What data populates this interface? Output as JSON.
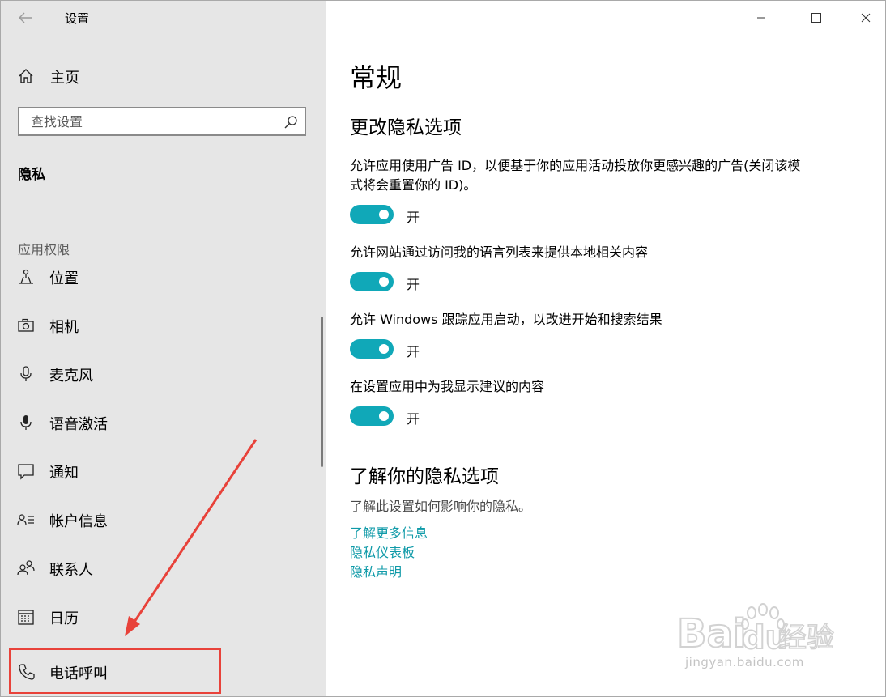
{
  "window": {
    "title": "设置",
    "controls": {
      "minimize": "minimize-icon",
      "maximize": "maximize-icon",
      "close": "close-icon"
    }
  },
  "sidebar": {
    "home_label": "主页",
    "search_placeholder": "查找设置",
    "section_label": "隐私",
    "group_label": "应用权限",
    "items": [
      {
        "label": "位置",
        "icon": "location-icon"
      },
      {
        "label": "相机",
        "icon": "camera-icon"
      },
      {
        "label": "麦克风",
        "icon": "microphone-icon"
      },
      {
        "label": "语音激活",
        "icon": "voice-activation-icon"
      },
      {
        "label": "通知",
        "icon": "notification-icon"
      },
      {
        "label": "帐户信息",
        "icon": "account-info-icon"
      },
      {
        "label": "联系人",
        "icon": "contacts-icon"
      },
      {
        "label": "日历",
        "icon": "calendar-icon"
      },
      {
        "label": "电话呼叫",
        "icon": "phone-icon",
        "highlighted": true
      }
    ]
  },
  "main": {
    "page_title": "常规",
    "sub_title": "更改隐私选项",
    "settings": [
      {
        "desc": "允许应用使用广告 ID，以便基于你的应用活动投放你更感兴趣的广告(关闭该模式将会重置你的 ID)。",
        "state": "开",
        "on": true
      },
      {
        "desc": "允许网站通过访问我的语言列表来提供本地相关内容",
        "state": "开",
        "on": true
      },
      {
        "desc": "允许 Windows 跟踪应用启动，以改进开始和搜索结果",
        "state": "开",
        "on": true
      },
      {
        "desc": "在设置应用中为我显示建议的内容",
        "state": "开",
        "on": true
      }
    ],
    "learn": {
      "title": "了解你的隐私选项",
      "desc": "了解此设置如何影响你的隐私。",
      "links": [
        "了解更多信息",
        "隐私仪表板",
        "隐私声明"
      ]
    }
  },
  "watermark": {
    "text": "jingyan.baidu.com",
    "logo": "Baidu经验"
  },
  "colors": {
    "accent": "#10a8b8",
    "link": "#0f9aa8",
    "sidebar_bg": "#e6e6e6",
    "highlight": "#e8423a"
  }
}
